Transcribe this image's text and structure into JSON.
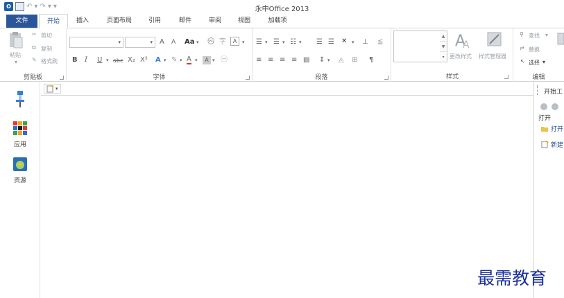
{
  "window": {
    "title": "永中Office 2013"
  },
  "quick_access": {
    "undo_glyph": "↶",
    "redo_glyph": "↷",
    "more_glyph": "▾"
  },
  "tabs": [
    {
      "label": "文件"
    },
    {
      "label": "开始"
    },
    {
      "label": "插入"
    },
    {
      "label": "页面布局"
    },
    {
      "label": "引用"
    },
    {
      "label": "邮件"
    },
    {
      "label": "审阅"
    },
    {
      "label": "视图"
    },
    {
      "label": "加载项"
    }
  ],
  "ribbon": {
    "clipboard": {
      "label": "剪贴板",
      "paste": "粘贴",
      "cut": "剪切",
      "copy": "复制",
      "format_painter": "格式刷"
    },
    "font": {
      "label": "字体",
      "font_name": "",
      "font_size": "",
      "grow": "A",
      "shrink": "A",
      "case": "Aa",
      "bold": "B",
      "italic": "I",
      "underline": "U",
      "strike": "abc",
      "subscript": "X₂",
      "superscript": "X²"
    },
    "paragraph": {
      "label": "段落",
      "show_marks": "¶"
    },
    "styles": {
      "label": "样式",
      "change_styles": "更改样式",
      "style_manager": "样式管理器"
    },
    "editing": {
      "label": "编辑",
      "find": "查找",
      "replace": "替换",
      "select": "选择"
    }
  },
  "sidebar": {
    "items": [
      {
        "label": ""
      },
      {
        "label": "应用"
      },
      {
        "label": "资源"
      }
    ]
  },
  "task_pane": {
    "title": "开始工",
    "section": "打开",
    "links": [
      {
        "label": "打开"
      },
      {
        "label": "新建"
      }
    ]
  },
  "watermark": {
    "text": "最需教育"
  },
  "colors": {
    "file_tab": "#2b579a",
    "accent": "#2b579a",
    "link": "#1f4e9c",
    "watermark": "#1b2f9c"
  }
}
